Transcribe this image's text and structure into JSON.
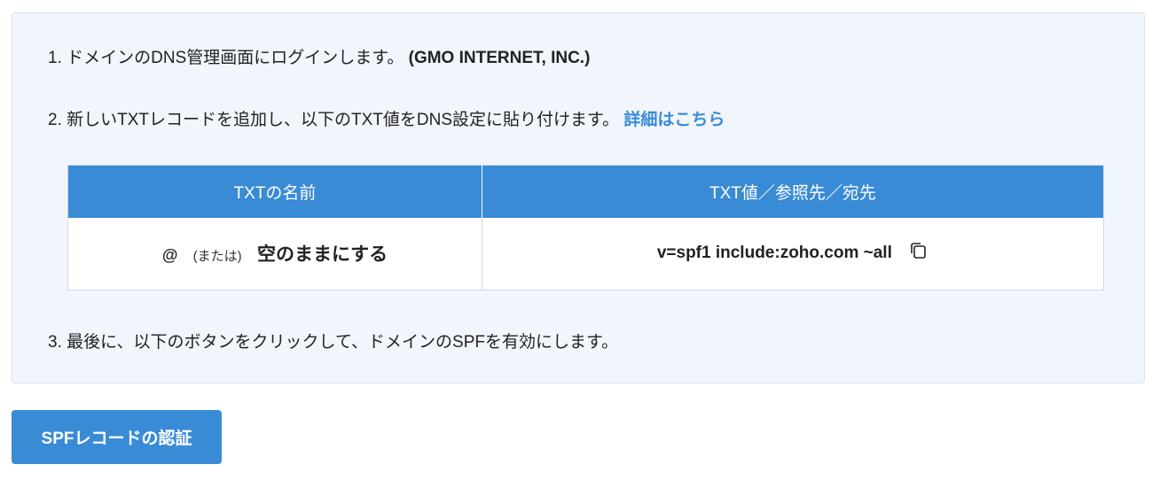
{
  "steps": {
    "step1_text": "1. ドメインのDNS管理画面にログインします。",
    "step1_provider": "(GMO INTERNET, INC.)",
    "step2_text": "2. 新しいTXTレコードを追加し、以下のTXT値をDNS設定に貼り付けます。",
    "step2_link": "詳細はこちら",
    "step3_text": "3. 最後に、以下のボタンをクリックして、ドメインのSPFを有効にします。"
  },
  "table": {
    "headers": [
      "TXTの名前",
      "TXT値／参照先／宛先"
    ],
    "name_at": "@",
    "name_or": "(または)",
    "name_empty": "空のままにする",
    "value": "v=spf1 include:zoho.com ~all"
  },
  "button": {
    "label": "SPFレコードの認証"
  },
  "icons": {
    "copy": "copy-icon"
  },
  "colors": {
    "accent": "#3a8bd6",
    "panel_bg": "#f1f5fc"
  }
}
